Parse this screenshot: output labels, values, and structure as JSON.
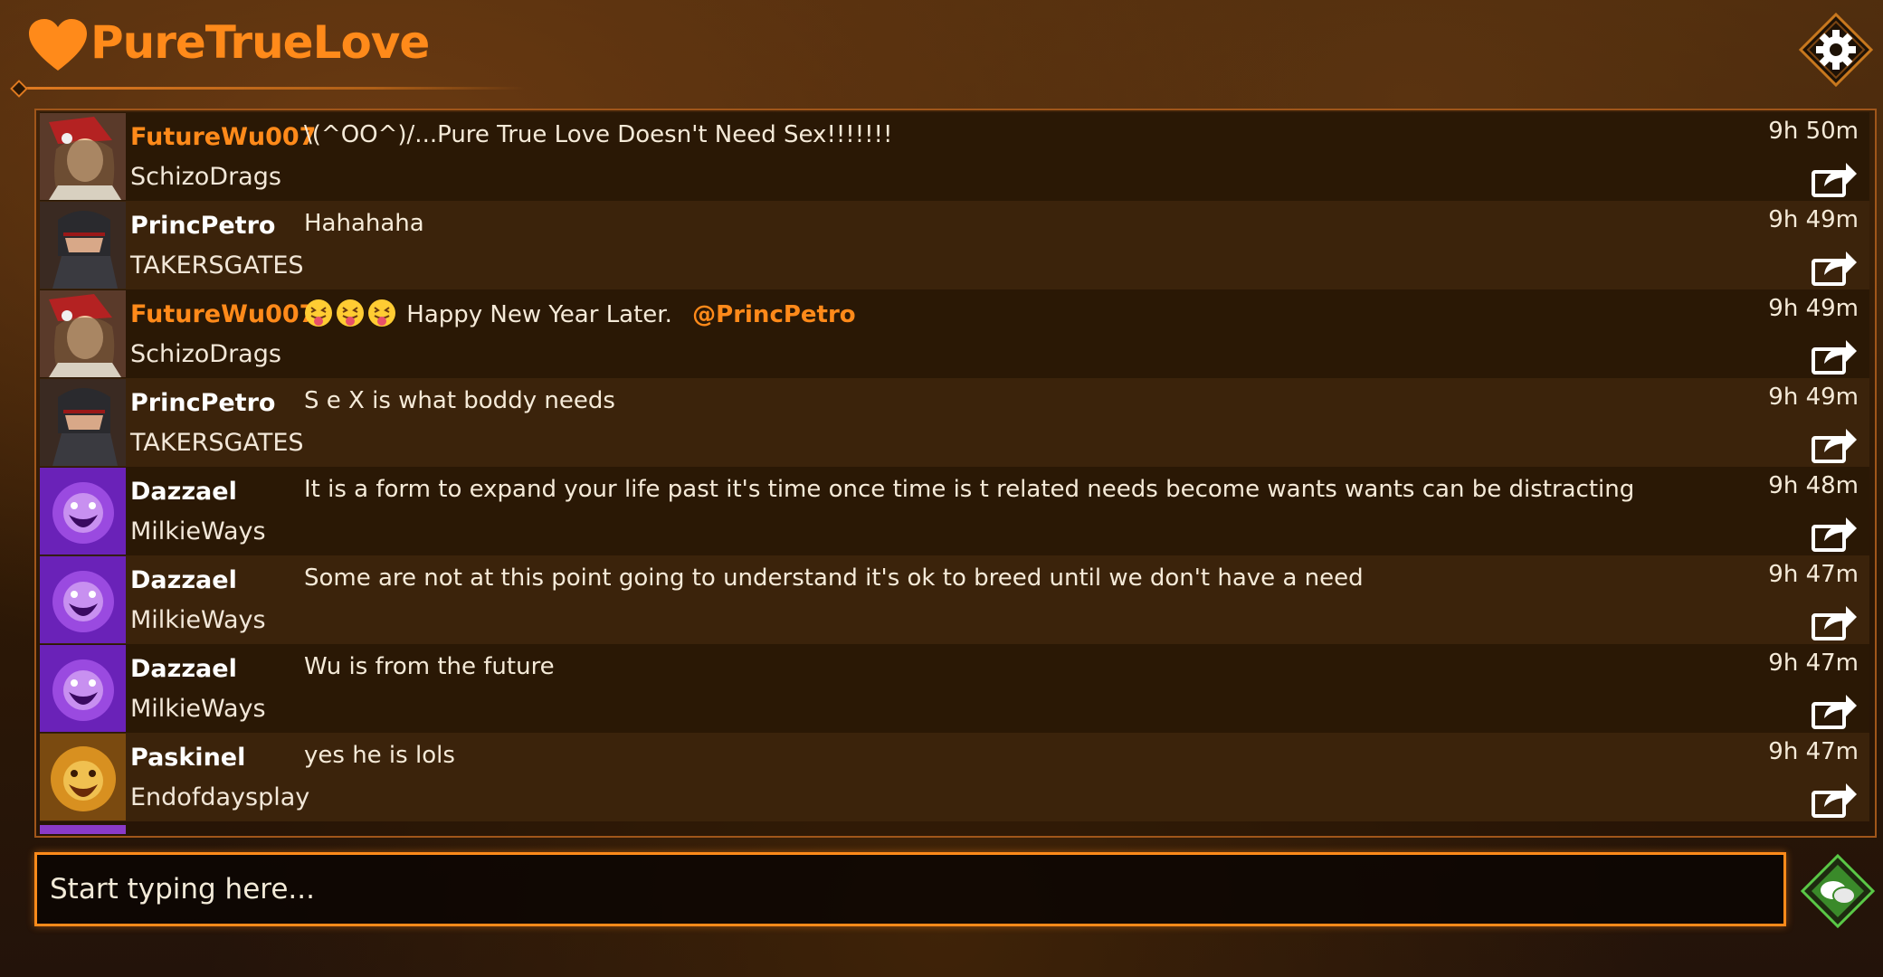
{
  "app": {
    "title": "PureTrueLove"
  },
  "colors": {
    "accent": "#ff8a1a",
    "row_dark": "#2a1805",
    "row_light": "#3b230b",
    "send_green": "#5ac846"
  },
  "messages": [
    {
      "username": "FutureWu007",
      "highlight": true,
      "subname": "SchizoDrags",
      "avatar": "female-warrior",
      "text": "\\(^OO^)/...Pure True Love Doesn't Need Sex!!!!!!!",
      "time": "9h 50m"
    },
    {
      "username": "PrincPetro",
      "highlight": false,
      "subname": "TAKERSGATES",
      "avatar": "helmeted-knight",
      "text": "Hahahaha",
      "time": "9h 49m"
    },
    {
      "username": "FutureWu007",
      "highlight": true,
      "subname": "SchizoDrags",
      "avatar": "female-warrior",
      "emojis": [
        "tongue-out-emoji",
        "tongue-out-emoji",
        "tongue-out-emoji"
      ],
      "text": "Happy New Year Later.",
      "mention": "@PrincPetro",
      "time": "9h 49m"
    },
    {
      "username": "PrincPetro",
      "highlight": false,
      "subname": "TAKERSGATES",
      "avatar": "helmeted-knight",
      "text": "S e X is what boddy needs",
      "time": "9h 49m"
    },
    {
      "username": "Dazzael",
      "highlight": false,
      "subname": "MilkieWays",
      "avatar": "purple-beast",
      "text": "It is a form to expand your life past it's time  once time is t related  needs become wants wants can be distracting",
      "time": "9h 48m"
    },
    {
      "username": "Dazzael",
      "highlight": false,
      "subname": "MilkieWays",
      "avatar": "purple-beast",
      "text": "Some are not at this point going to understand it's ok  to breed until we don't have a need",
      "time": "9h 47m"
    },
    {
      "username": "Dazzael",
      "highlight": false,
      "subname": "MilkieWays",
      "avatar": "purple-beast",
      "text": "Wu is from the future",
      "time": "9h 47m"
    },
    {
      "username": "Paskinel",
      "highlight": false,
      "subname": "Endofdaysplay",
      "avatar": "golden-lion",
      "text": "yes he is lols",
      "time": "9h 47m"
    }
  ],
  "input": {
    "placeholder": "Start typing here..."
  }
}
